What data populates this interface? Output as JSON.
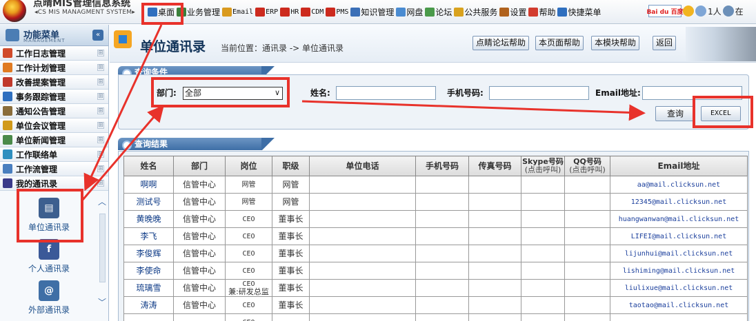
{
  "header": {
    "system_name": "点晴MIS管理信息系统",
    "system_name_en": "◂CS MIS MANAGMENT SYSTEM▸",
    "menu": [
      {
        "label": "桌面",
        "color": "#2f6fbf"
      },
      {
        "label": "业务管理",
        "color": "#3b7f3b"
      },
      {
        "label": "Email",
        "color": "#d99a1e"
      },
      {
        "label": "ERP",
        "color": "#cc2a1e"
      },
      {
        "label": "HR",
        "color": "#cc2a1e"
      },
      {
        "label": "CDM",
        "color": "#cc2a1e"
      },
      {
        "label": "PMS",
        "color": "#cc2a1e"
      },
      {
        "label": "知识管理",
        "color": "#3a6fb7"
      },
      {
        "label": "网盘",
        "color": "#4a8bd1"
      },
      {
        "label": "论坛",
        "color": "#4a9a4a"
      },
      {
        "label": "公共服务",
        "color": "#d9a21e"
      },
      {
        "label": "设置",
        "color": "#b0621e"
      },
      {
        "label": "帮助",
        "color": "#d23b2e"
      },
      {
        "label": "快捷菜单",
        "color": "#2f6fbf"
      }
    ],
    "search_engine": "Bai du 百度",
    "online": "1人",
    "tail": "在"
  },
  "sidebar": {
    "title": "功能菜单",
    "subtitle": "MANAGEMENT",
    "collapse_icon": "«",
    "items": [
      {
        "label": "工作日志管理",
        "color": "#d04a2a"
      },
      {
        "label": "工作计划管理",
        "color": "#e07b22"
      },
      {
        "label": "改善提案管理",
        "color": "#c0392b"
      },
      {
        "label": "事务跟踪管理",
        "color": "#2f6fbf"
      },
      {
        "label": "通知公告管理",
        "color": "#8a6d3b"
      },
      {
        "label": "单位会议管理",
        "color": "#d19a1a"
      },
      {
        "label": "单位新闻管理",
        "color": "#4a8a4a"
      },
      {
        "label": "工作联络单",
        "color": "#2f8fbf"
      },
      {
        "label": "工作流管理",
        "color": "#4a7fbf"
      },
      {
        "label": "我的通讯录",
        "color": "#3a3a8a"
      }
    ],
    "plus": "⊞",
    "sub_items": [
      {
        "label": "单位通讯录",
        "icon_color": "#3d5f8f",
        "glyph": "▤"
      },
      {
        "label": "个人通讯录",
        "icon_color": "#3b5998",
        "glyph": "f"
      },
      {
        "label": "外部通讯录",
        "icon_color": "#3f6fa6",
        "glyph": "@"
      }
    ]
  },
  "page": {
    "title": "单位通讯录",
    "breadcrumb": "当前位置：通讯录 -> 单位通讯录",
    "buttons": [
      "点睛论坛帮助",
      "本页面帮助",
      "本模块帮助",
      "返回"
    ]
  },
  "query": {
    "tab_label": "查询条件",
    "dept_label": "部门:",
    "dept_value": "全部",
    "name_label": "姓名:",
    "phone_label": "手机号码:",
    "email_label": "Email地址:",
    "search_button": "查询",
    "excel_button": "EXCEL"
  },
  "results": {
    "tab_label": "查询结果",
    "columns": [
      {
        "label": "姓名",
        "sub": ""
      },
      {
        "label": "部门",
        "sub": ""
      },
      {
        "label": "岗位",
        "sub": ""
      },
      {
        "label": "职级",
        "sub": ""
      },
      {
        "label": "单位电话",
        "sub": ""
      },
      {
        "label": "手机号码",
        "sub": ""
      },
      {
        "label": "传真号码",
        "sub": ""
      },
      {
        "label": "Skype号码",
        "sub": "(点击呼叫)"
      },
      {
        "label": "QQ号码",
        "sub": "(点击呼叫)"
      },
      {
        "label": "Email地址",
        "sub": ""
      }
    ],
    "rows": [
      {
        "name": "啊啊",
        "dept": "信管中心",
        "post": "网管",
        "post2": "",
        "level": "网管",
        "email": "aa@mail.clicksun.net"
      },
      {
        "name": "测试号",
        "dept": "信管中心",
        "post": "网管",
        "post2": "",
        "level": "网管",
        "email": "12345@mail.clicksun.net"
      },
      {
        "name": "黄晚晚",
        "dept": "信管中心",
        "post": "CEO",
        "post2": "",
        "level": "董事长",
        "email": "huangwanwan@mail.clicksun.net"
      },
      {
        "name": "李飞",
        "dept": "信管中心",
        "post": "CEO",
        "post2": "",
        "level": "董事长",
        "email": "LIFEI@mail.clicksun.net"
      },
      {
        "name": "李俊辉",
        "dept": "信管中心",
        "post": "CEO",
        "post2": "",
        "level": "董事长",
        "email": "lijunhui@mail.clicksun.net"
      },
      {
        "name": "李使命",
        "dept": "信管中心",
        "post": "CEO",
        "post2": "",
        "level": "董事长",
        "email": "lishiming@mail.clicksun.net"
      },
      {
        "name": "琉璃雪",
        "dept": "信管中心",
        "post": "CEO",
        "post2": "兼:研发总监",
        "level": "董事长",
        "email": "liulixue@mail.clicksun.net"
      },
      {
        "name": "涛涛",
        "dept": "信管中心",
        "post": "CEO",
        "post2": "",
        "level": "董事长",
        "email": "taotao@mail.clicksun.net"
      },
      {
        "name": "",
        "dept": "",
        "post": "CEO",
        "post2": "",
        "level": "",
        "email": ""
      }
    ]
  },
  "annotation_color": "#e8322b"
}
